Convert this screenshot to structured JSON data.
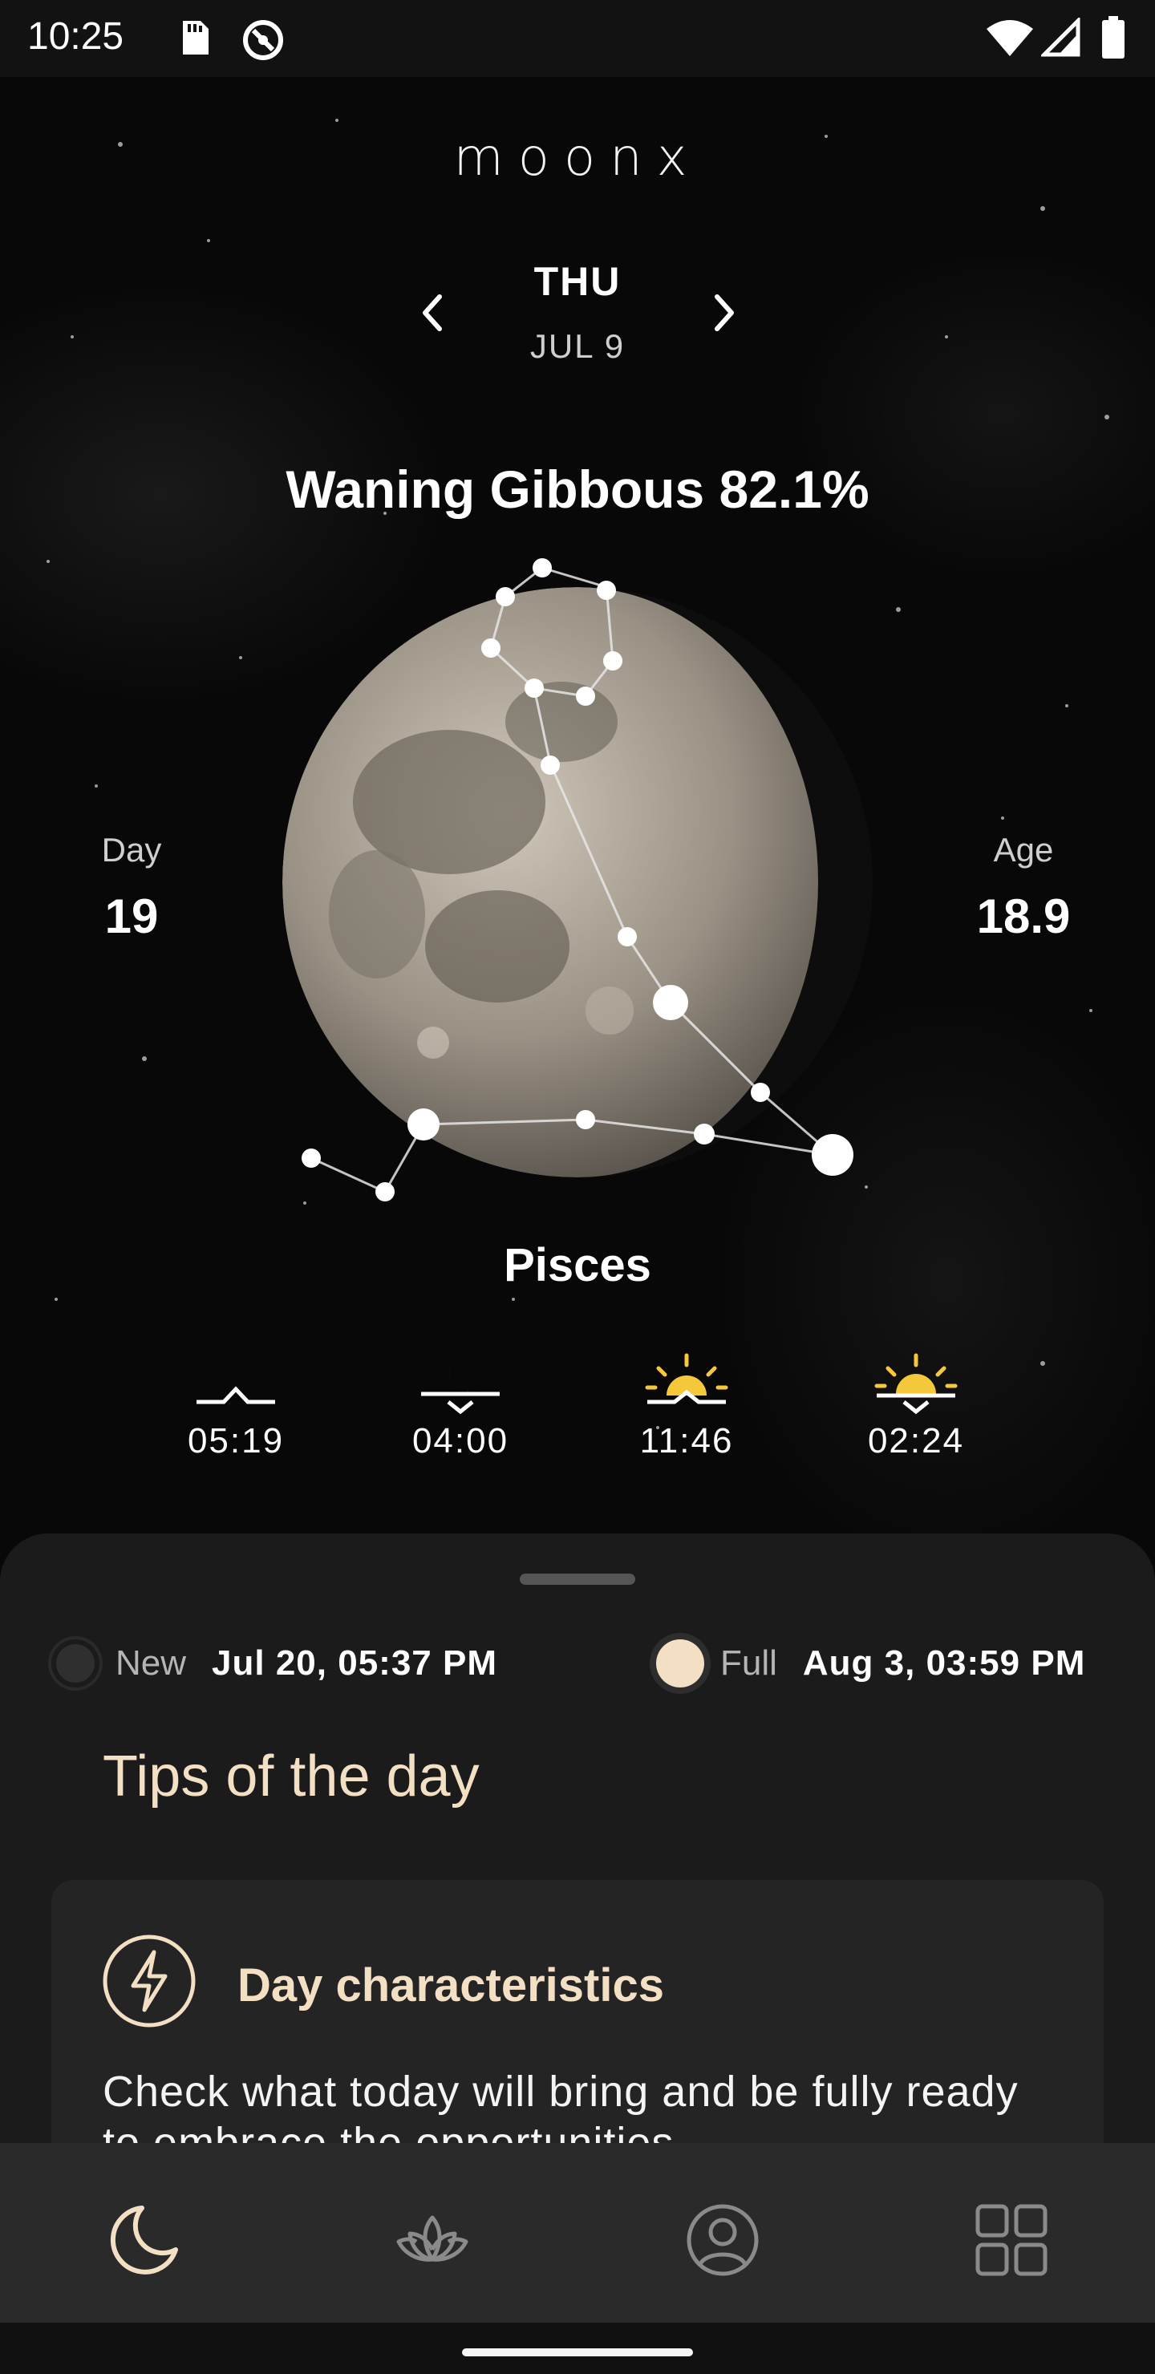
{
  "status_bar": {
    "time": "10:25",
    "icons": [
      "sd-card-icon",
      "data-saver-icon",
      "wifi-icon",
      "signal-icon",
      "battery-icon"
    ]
  },
  "app": {
    "logo": "moonx"
  },
  "date_nav": {
    "day": "THU",
    "date": "JUL 9"
  },
  "moon": {
    "phase_title": "Waning Gibbous 82.1%",
    "illumination_percent": 82.1,
    "day_label": "Day",
    "day_value": "19",
    "age_label": "Age",
    "age_value": "18.9",
    "zodiac_sign": "Pisces"
  },
  "events": [
    {
      "icon": "moonrise-icon",
      "time": "05:19"
    },
    {
      "icon": "moonset-icon",
      "time": "04:00"
    },
    {
      "icon": "sunset-icon",
      "time": "11:46"
    },
    {
      "icon": "sunrise-icon",
      "time": "02:24"
    }
  ],
  "upcoming": {
    "new": {
      "label": "New",
      "date": "Jul 20, 05:37 PM"
    },
    "full": {
      "label": "Full",
      "date": "Aug 3, 03:59 PM"
    }
  },
  "tips": {
    "section_title": "Tips of the day",
    "card_title": "Day characteristics",
    "card_text": "Check what today will bring and be fully ready to embrace the opportunities."
  },
  "bottom_nav": [
    {
      "name": "moon-icon",
      "active": true
    },
    {
      "name": "lotus-icon",
      "active": false
    },
    {
      "name": "profile-icon",
      "active": false
    },
    {
      "name": "grid-icon",
      "active": false
    }
  ],
  "colors": {
    "accent": "#f3dfc4",
    "sun_yellow": "#f5c83c",
    "sheet_bg": "#1b1b1b",
    "nav_bg": "#2a2a2a"
  }
}
